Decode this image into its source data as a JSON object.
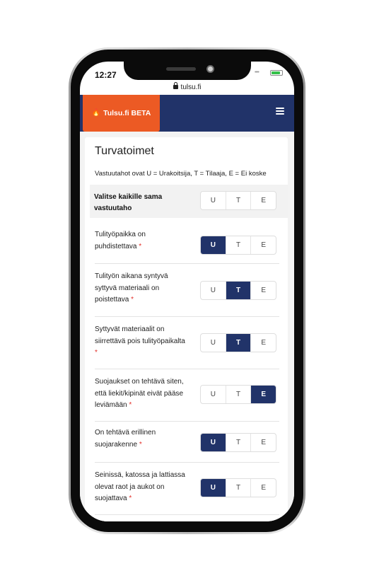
{
  "status": {
    "time": "12:27"
  },
  "browser": {
    "url": "tulsu.fi"
  },
  "nav": {
    "brand": "Tulsu.fi BETA"
  },
  "page": {
    "title": "Turvatoimet",
    "legend": "Vastuutahot ovat U = Urakoitsija, T = Tilaaja, E = Ei koske",
    "select_all_label": "Valitse kaikille sama vastuutaho",
    "options": [
      "U",
      "T",
      "E"
    ],
    "required_mark": "*"
  },
  "rows": [
    {
      "label": "Tulityöpaikka on puhdistettava",
      "selected": "U"
    },
    {
      "label": "Tulityön aikana syntyvä syttyvä materiaali on poistettava",
      "selected": "T"
    },
    {
      "label": "Syttyvät materiaalit on siirrettävä pois tulityöpaikalta",
      "selected": "T"
    },
    {
      "label": "Suojaukset on tehtävä siten, että liekit/kipinät eivät pääse leviämään",
      "selected": "E"
    },
    {
      "label": "On tehtävä erillinen suojarakenne",
      "selected": "U"
    },
    {
      "label": "Seinissä, katossa ja lattiassa olevat raot ja aukot on suojattava",
      "selected": "U"
    }
  ],
  "colors": {
    "navy": "#213369",
    "brand_orange": "#ec5a24",
    "required": "#e3312b"
  }
}
